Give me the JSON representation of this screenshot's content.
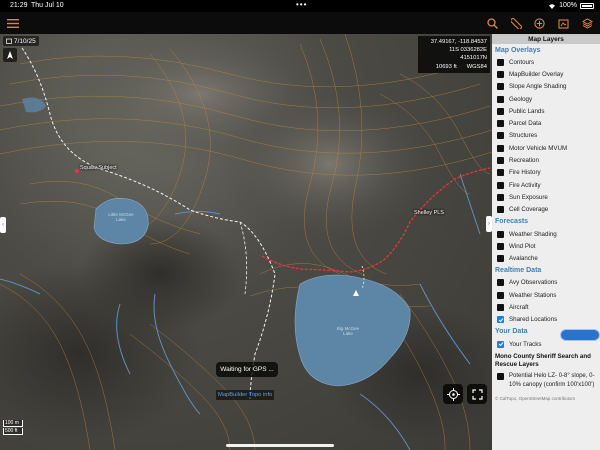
{
  "status_bar": {
    "time": "21:29",
    "date": "Thu Jul 10",
    "battery": "100%"
  },
  "toolbar": {
    "left_icon": "menu-icon",
    "right_icons": [
      "search-icon",
      "ruler-icon",
      "add-icon",
      "map-pin-icon",
      "layers-icon"
    ]
  },
  "map": {
    "date_badge": "7/10/25",
    "coords": {
      "latlon": "37.49167, -118.84537",
      "utm": "11S 0336282E 4151017N",
      "elevation": "10693 ft",
      "datum": "WGS84"
    },
    "waypoints": [
      {
        "label": "Squaw Subject"
      },
      {
        "label": "Shelley PLS"
      }
    ],
    "lakes": [
      {
        "label": "Little McGee Lake"
      },
      {
        "label": "Big McGee Lake"
      }
    ],
    "scale": {
      "metric": "100 m",
      "imperial": "500 ft"
    },
    "gps_status": "Waiting for GPS ...",
    "layer_info": "MapBuilder Topo info"
  },
  "panel": {
    "title": "Map Layers",
    "sections": [
      {
        "title": "Map Overlays",
        "items": [
          {
            "label": "Contours",
            "checked": false
          },
          {
            "label": "MapBuilder Overlay",
            "checked": false
          },
          {
            "label": "Slope Angle Shading",
            "checked": false
          },
          {
            "label": "Geology",
            "checked": false
          },
          {
            "label": "Public Lands",
            "checked": false
          },
          {
            "label": "Parcel Data",
            "checked": false
          },
          {
            "label": "Structures",
            "checked": false
          },
          {
            "label": "Motor Vehicle MVUM",
            "checked": false
          },
          {
            "label": "Recreation",
            "checked": false
          },
          {
            "label": "Fire History",
            "checked": false
          },
          {
            "label": "Fire Activity",
            "checked": false
          },
          {
            "label": "Sun Exposure",
            "checked": false
          },
          {
            "label": "Cell Coverage",
            "checked": false
          }
        ]
      },
      {
        "title": "Forecasts",
        "items": [
          {
            "label": "Weather Shading",
            "checked": false
          },
          {
            "label": "Wind Plot",
            "checked": false
          },
          {
            "label": "Avalanche",
            "checked": false
          }
        ]
      },
      {
        "title": "Realtime Data",
        "items": [
          {
            "label": "Avy Observations",
            "checked": false
          },
          {
            "label": "Weather Stations",
            "checked": false
          },
          {
            "label": "Aircraft",
            "checked": false
          },
          {
            "label": "Shared Locations",
            "checked": true
          }
        ]
      },
      {
        "title": "Your Data",
        "items": [
          {
            "label": "Your Tracks",
            "checked": true
          }
        ]
      }
    ],
    "sheriff": {
      "title": "Mono County Sheriff Search and Rescue Layers",
      "item": {
        "label": "Potential Helo LZ- 0-8° slope, 0-10% canopy (confirm 100'x100')",
        "checked": false
      }
    },
    "credits": "© CalTopo, OpenStreetMap contributors"
  },
  "colors": {
    "accent": "#e0853a",
    "section": "#3d7fb8",
    "checkbox_on": "#1a7ee6",
    "track": "#e8353a",
    "water": "#5d85a6"
  }
}
